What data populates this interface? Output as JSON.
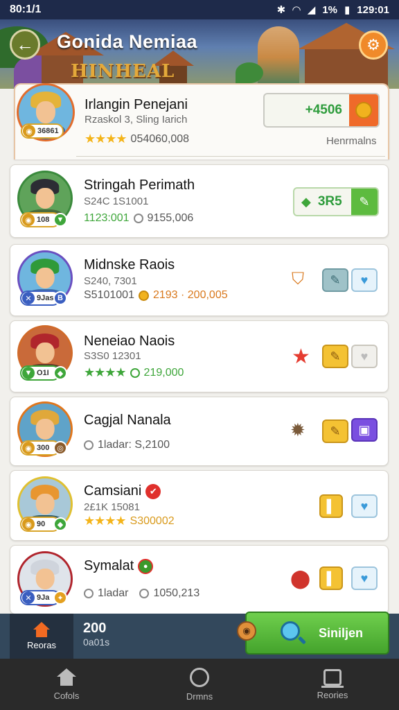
{
  "status_bar": {
    "time": "80:1/1",
    "battery_pct": "1%",
    "clock_right": "129:01"
  },
  "header": {
    "title": "Gonida Nemiaa",
    "logo_text": "HINHEAL"
  },
  "featured": {
    "name": "Irlangin Penejani",
    "subtitle": "Rzaskol 3, Sling Iarich",
    "stars": "★★★★",
    "stat_value": "054060,008",
    "level": "36861",
    "price": "+4506",
    "rank_label": "Henrmalns"
  },
  "players": [
    {
      "name": "Stringah Perimath",
      "subtitle": "S24C 1S1001",
      "stat_value": "1123:001",
      "stat_value2": "9155,006",
      "level": "108",
      "price": "3R5",
      "colors": {
        "hair": "#2c2c34",
        "body": "#4a6a3c",
        "ring": "#3a8a3c"
      }
    },
    {
      "name": "Midnske Raois",
      "subtitle": "S240, 7301",
      "stat_value": "S5101001",
      "stat_value2": "2193 · 200,005",
      "level": "9Jas",
      "colors": {
        "hair": "#2f9a3a",
        "body": "#3f6fa8",
        "ring": "#6a4fc0"
      }
    },
    {
      "name": "Neneiao Naois",
      "subtitle": "S3S0 12301",
      "stat_value": "219,000",
      "level": "O1I",
      "colors": {
        "hair": "#b0262c",
        "body": "#5a3a2a",
        "ring": "#d06a2a"
      }
    },
    {
      "name": "Cagjal Nanala",
      "subtitle": "",
      "stat_value": "1ladar: S,2100",
      "level": "300",
      "colors": {
        "hair": "#e0a83a",
        "body": "#3c6a9a",
        "ring": "#e0761c"
      }
    },
    {
      "name": "Camsiani",
      "subtitle": "2£1K 15081",
      "stat_value": "S300002",
      "level": "90",
      "colors": {
        "hair": "#e89630",
        "body": "#2e5c6a",
        "ring": "#e0c030"
      }
    },
    {
      "name": "Symalat",
      "subtitle": "",
      "stat_value": "1ladar",
      "stat_value2": "1050,213",
      "level": "9Ja",
      "colors": {
        "hair": "#cfd4dc",
        "body": "#3a3f5a",
        "ring": "#b0242c"
      }
    }
  ],
  "action_bar": {
    "home_label": "Reoras",
    "count": "200",
    "count_sub": "0a01s",
    "primary_label": "Siniljen"
  },
  "nav": {
    "home": "Cofols",
    "center": "Drmns",
    "recent": "Reories"
  }
}
